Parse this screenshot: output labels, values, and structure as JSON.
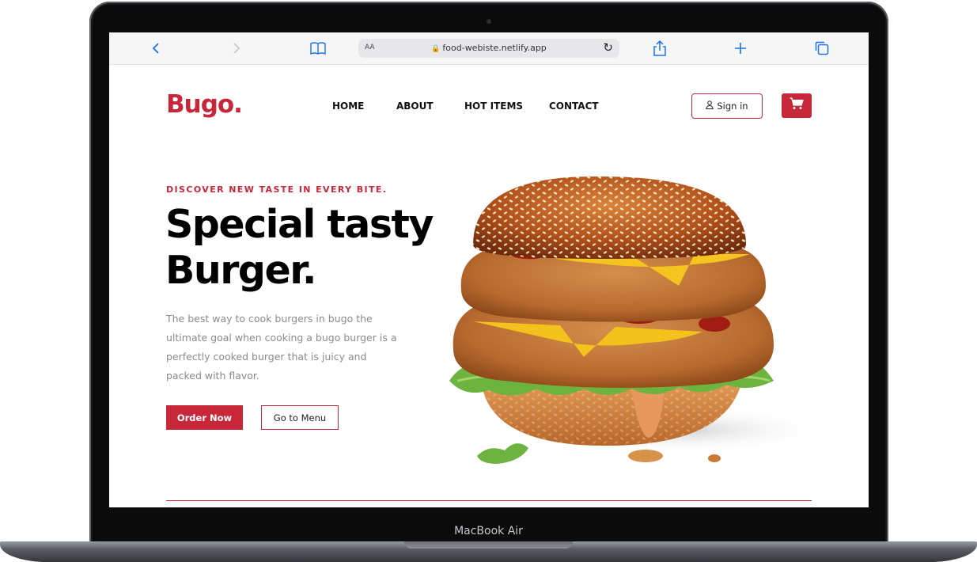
{
  "device": {
    "label": "MacBook Air"
  },
  "browser": {
    "url": "food-webiste.netlify.app",
    "reader_label": "AA"
  },
  "site": {
    "logo": "Bugo.",
    "nav": [
      {
        "label": "HOME"
      },
      {
        "label": "ABOUT"
      },
      {
        "label": "HOT ITEMS"
      },
      {
        "label": "CONTACT"
      }
    ],
    "signin_label": "Sign in"
  },
  "hero": {
    "tagline": "DISCOVER NEW TASTE IN EVERY BITE.",
    "headline_line1": "Special tasty",
    "headline_line2": "Burger.",
    "description": "The best way to cook burgers in bugo the ultimate goal when cooking a bugo burger is a perfectly cooked burger that is juicy and packed with flavor.",
    "primary_button": "Order Now",
    "secondary_button": "Go to Menu"
  },
  "colors": {
    "accent": "#c8273a",
    "text": "#111111",
    "muted": "#8a8a8a"
  },
  "icons": [
    "back-icon",
    "forward-icon",
    "bookmarks-icon",
    "lock-icon",
    "reload-icon",
    "share-icon",
    "new-tab-icon",
    "tabs-icon",
    "user-icon",
    "cart-icon"
  ]
}
